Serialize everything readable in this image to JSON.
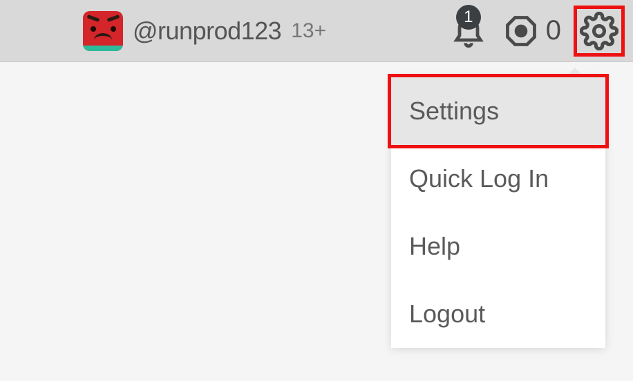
{
  "header": {
    "username": "@runprod123",
    "age_label": "13+",
    "notification_count": "1",
    "robux_count": "0"
  },
  "menu": {
    "items": [
      "Settings",
      "Quick Log In",
      "Help",
      "Logout"
    ]
  }
}
